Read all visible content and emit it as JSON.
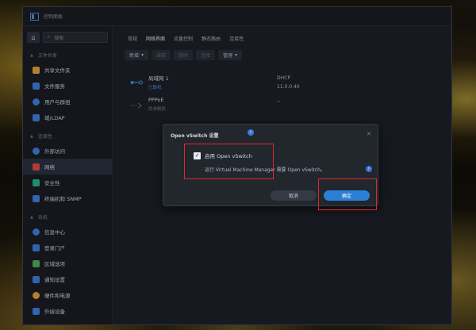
{
  "window": {
    "title": "控制面板"
  },
  "sidebar": {
    "search_placeholder": "搜索",
    "sections": [
      {
        "label": "文件共享",
        "items": [
          {
            "label": "共享文件夹",
            "icon": "folder-icon",
            "color": "#e8a33c"
          },
          {
            "label": "文件服务",
            "icon": "file-services-icon",
            "color": "#3f7fe0"
          }
        ]
      },
      {
        "label": "",
        "items": [
          {
            "label": "用户与群组",
            "icon": "users-icon",
            "color": "#3f7fe0"
          },
          {
            "label": "域/LDAP",
            "icon": "domain-icon",
            "color": "#3f7fe0"
          }
        ]
      },
      {
        "label": "连接性",
        "items": [
          {
            "label": "外部访问",
            "icon": "external-access-icon",
            "color": "#3f7fe0"
          },
          {
            "label": "网络",
            "icon": "network-icon",
            "color": "#e04b4b"
          },
          {
            "label": "安全性",
            "icon": "security-icon",
            "color": "#2bb58a"
          },
          {
            "label": "终端机和 SNMP",
            "icon": "terminal-icon",
            "color": "#3f7fe0"
          }
        ]
      },
      {
        "label": "系统",
        "items": [
          {
            "label": "信息中心",
            "icon": "info-center-icon",
            "color": "#3f7fe0"
          },
          {
            "label": "登录门户",
            "icon": "login-portal-icon",
            "color": "#3f7fe0"
          },
          {
            "label": "区域选项",
            "icon": "regional-options-icon",
            "color": "#55b05a"
          },
          {
            "label": "通知设置",
            "icon": "notification-icon",
            "color": "#3f7fe0"
          },
          {
            "label": "硬件和电源",
            "icon": "hardware-power-icon",
            "color": "#e8a33c"
          },
          {
            "label": "外接设备",
            "icon": "external-devices-icon",
            "color": "#3f7fe0"
          }
        ]
      }
    ]
  },
  "tabs": [
    "常规",
    "网络界面",
    "流量控制",
    "静态路由",
    "连接性"
  ],
  "toolbar": {
    "new": "新增",
    "edit": "编辑",
    "delete": "删除",
    "connect": "连接",
    "manage": "管理"
  },
  "interfaces": [
    {
      "name": "局域网 1",
      "status": "已联机",
      "status_color": "#4a8fe6",
      "type": "DHCP",
      "ip": "11.0.0.40"
    },
    {
      "name": "PPPoE",
      "status": "尚未联机",
      "status_color": "#7a808a",
      "type": "",
      "ip": "--"
    }
  ],
  "dialog": {
    "title": "Open vSwitch 设置",
    "checkbox_label": "启用 Open vSwitch",
    "checked": true,
    "note": "运行 Virtual Machine Manager 需要 Open vSwitch。",
    "cancel": "取消",
    "ok": "确定",
    "info_mark": "i"
  }
}
